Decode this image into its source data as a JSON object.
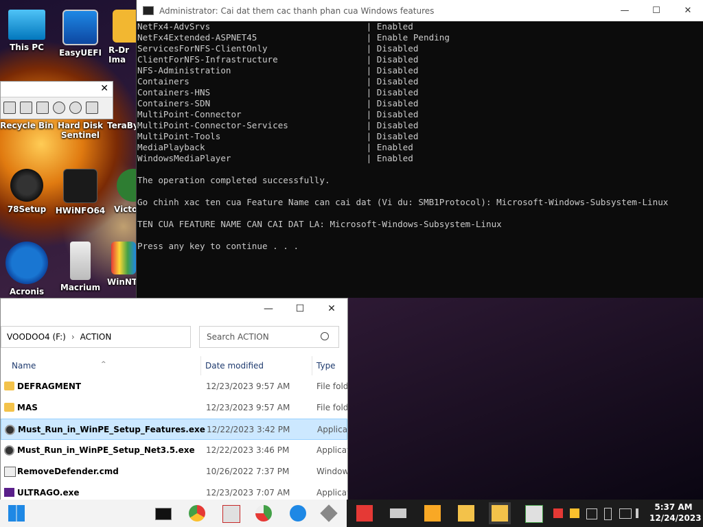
{
  "desktop": {
    "icons": [
      {
        "label": "This PC"
      },
      {
        "label": "EasyUEFI"
      },
      {
        "label": "R-Dr Ima"
      },
      {
        "label": "Recycle Bin"
      },
      {
        "label": "Hard Disk Sentinel"
      },
      {
        "label": "TeraBy"
      },
      {
        "label": "78Setup"
      },
      {
        "label": "HWiNFO64"
      },
      {
        "label": "Victo"
      },
      {
        "label": "Acronis True"
      },
      {
        "label": "Macrium"
      },
      {
        "label": "WinNT"
      }
    ],
    "toolbar_close": "✕"
  },
  "console": {
    "title": "Administrator:  Cai dat them cac thanh phan cua Windows features",
    "controls": {
      "minimize": "—",
      "maximize": "☐",
      "close": "✕"
    },
    "lines": [
      "NetFx4-AdvSrvs                              | Enabled",
      "NetFx4Extended-ASPNET45                     | Enable Pending",
      "ServicesForNFS-ClientOnly                   | Disabled",
      "ClientForNFS-Infrastructure                 | Disabled",
      "NFS-Administration                          | Disabled",
      "Containers                                  | Disabled",
      "Containers-HNS                              | Disabled",
      "Containers-SDN                              | Disabled",
      "MultiPoint-Connector                        | Disabled",
      "MultiPoint-Connector-Services               | Disabled",
      "MultiPoint-Tools                            | Disabled",
      "MediaPlayback                               | Enabled",
      "WindowsMediaPlayer                          | Enabled",
      "",
      "The operation completed successfully.",
      "",
      "Go chinh xac ten cua Feature Name can cai dat (Vi du: SMB1Protocol): Microsoft-Windows-Subsystem-Linux",
      "",
      "TEN CUA FEATURE NAME CAN CAI DAT LA: Microsoft-Windows-Subsystem-Linux",
      "",
      "Press any key to continue . . ."
    ]
  },
  "explorer": {
    "controls": {
      "minimize": "—",
      "maximize": "☐",
      "close": "✕"
    },
    "breadcrumb": [
      "VOODOO4 (F:)",
      "ACTION"
    ],
    "breadcrumb_sep": "›",
    "search_placeholder": "Search ACTION",
    "columns": {
      "name": "Name",
      "date": "Date modified",
      "type": "Type"
    },
    "sort_indicator": "^",
    "rows": [
      {
        "name": "DEFRAGMENT",
        "date": "12/23/2023 9:57 AM",
        "type": "File fold",
        "icon": "folder-icon"
      },
      {
        "name": "MAS",
        "date": "12/23/2023 9:57 AM",
        "type": "File fold",
        "icon": "folder-icon"
      },
      {
        "name": "Must_Run_in_WinPE_Setup_Features.exe",
        "date": "12/22/2023 3:42 PM",
        "type": "Applicat",
        "icon": "exe-icon",
        "selected": true
      },
      {
        "name": "Must_Run_in_WinPE_Setup_Net3.5.exe",
        "date": "12/22/2023 3:46 PM",
        "type": "Applicat",
        "icon": "exe-icon"
      },
      {
        "name": "RemoveDefender.cmd",
        "date": "10/26/2022 7:37 PM",
        "type": "Window",
        "icon": "cmd-file-icon"
      },
      {
        "name": "ULTRAGO.exe",
        "date": "12/23/2023 7:07 AM",
        "type": "Applicat",
        "icon": "app-icon"
      }
    ]
  },
  "taskbar": {
    "time": "5:37 AM",
    "date": "12/24/2023"
  }
}
